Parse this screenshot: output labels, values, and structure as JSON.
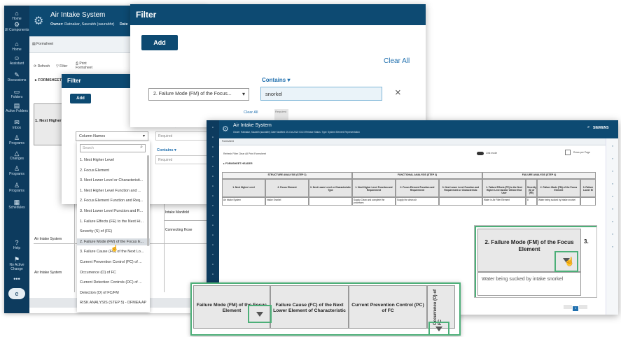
{
  "left_app": {
    "nav": [
      {
        "icon": "⌂",
        "label": "Home"
      },
      {
        "icon": "⚙",
        "label": "UI Components"
      },
      {
        "icon": "⌂",
        "label": "Home"
      },
      {
        "icon": "☺",
        "label": "Assistant"
      },
      {
        "icon": "✎",
        "label": "Discussions"
      },
      {
        "icon": "▭",
        "label": "Folders"
      },
      {
        "icon": "▤",
        "label": "Active Folders"
      },
      {
        "icon": "✉",
        "label": "Inbox"
      },
      {
        "icon": "♙",
        "label": "Programs"
      },
      {
        "icon": "△",
        "label": "Changes"
      },
      {
        "icon": "♙",
        "label": "Programs"
      },
      {
        "icon": "♙",
        "label": "Programs"
      },
      {
        "icon": "▦",
        "label": "Schedules"
      },
      {
        "icon": "?",
        "label": "Help"
      },
      {
        "icon": "⚑",
        "label": "No Active Change"
      },
      {
        "icon": "•••",
        "label": ""
      },
      {
        "icon": "e",
        "label": ""
      }
    ],
    "title": "Air Intake System",
    "owner_label": "Owner:",
    "owner_value": "Ratnakar, Saurabh (saurabhr)",
    "date_label": "Date",
    "tab": "Formsheet",
    "toolbar": {
      "refresh": "Refresh",
      "filter": "Filter",
      "print": "Print Formsheet"
    },
    "section": "FORMSHEET",
    "row_label": "1. Next Higher Level",
    "row_value_1": "Air Intake System",
    "row_value_2": "Air Intake System",
    "cells": {
      "intake_manifold": "Intake Manifold",
      "connecting_hose": "Connecting Hose"
    }
  },
  "small_filter": {
    "title": "Filter",
    "add": "Add",
    "contains_1": "Contains",
    "required_1": "Required",
    "contains_2": "Contains",
    "required_2": "Required",
    "select_value": "Column Names",
    "search_placeholder": "Search",
    "options": [
      "1. Next Higher Level",
      "2. Focus Element",
      "3. Next Lower Level or Characteristi...",
      "1. Next Higher Level Function and ...",
      "2. Focus Element Function and Req...",
      "3. Next Lower Level Function and R...",
      "1. Failure Effects (FE) to the Next Hi...",
      "Severity (S) of (FE)",
      "2. Failure Mode (FM) of the Focus E...",
      "3. Failure Cause (FC) of the Next Lo...",
      "Current Prevention Control (PC) of ...",
      "Occurrence (O) of FC",
      "Current Detection Controls (DC) of ...",
      "Detection (D) of FC/FM",
      "RISK ANALYSIS (STEP 5) - DFMEA AP"
    ]
  },
  "big_filter": {
    "title": "Filter",
    "add": "Add",
    "clear_all": "Clear All",
    "contains": "Contains",
    "select_value": "2. Failure Mode (FM) of the Focus...",
    "input_value": "snorkel",
    "close": "×",
    "clear_all_small": "Clear All",
    "required": "Required"
  },
  "right_app": {
    "title": "Air Intake System",
    "meta": "Owner:  Ratnakar, Saurabh (saurabhr)     Date Modified:  20-Oct-2022 03:23     Release Status:      Type:  System Element Representation",
    "brand": "SIEMENS",
    "tab": "Formsheet",
    "toolbar": "Refresh   Filter   Clear All   Print Formsheet",
    "toggle_label": "Link mode",
    "rows_per_page": "Rows per Page",
    "section": "FORMSHEET HEADER",
    "groups": [
      "STRUCTURE ANALYSIS (STEP 2)",
      "FUNCTIONAL ANALYSIS (STEP 3)",
      "FAILURE ANALYSIS (STEP 4)"
    ],
    "headers": [
      "1. Next Higher Level",
      "2. Focus Element",
      "3. Next Lower Level or Characteristic Type",
      "1. Next Higher Level Function and Requirement",
      "2. Focus Element Function and Requirement",
      "3. Next Lower Level Function and Requirement or Characteristic",
      "1. Failure Effects (FE) to the Next Higher Level and/or Vehicle End User",
      "Severity (S) of (FE)",
      "2. Failure Mode (FM) of the Focus Element",
      "3. Failure Lower El"
    ],
    "row": [
      "Air Intake System",
      "Intake Snorkel",
      "",
      "Supply Clean and complete the processes",
      "Supply the clean air",
      "",
      "Water in Air Filter Element",
      "8",
      "Water being sucked by intake snorkel",
      ""
    ],
    "zoom_header": "2. Failure Mode (FM) of the Focus Element",
    "zoom_header_cut": "3.",
    "zoom_cell": "Water being sucked by intake snorkel",
    "pager": "1",
    "side_icons": [
      "Information",
      "Discussions",
      "Gallery",
      "Tags",
      "Groups",
      "Properties",
      "Favorites",
      "Settings",
      "More"
    ]
  },
  "bottom_zoom": {
    "h1": "Failure Mode (FM) of the Focus Element",
    "h2": "Failure Cause (FC) of the Next Lower Element of Characteristic",
    "h3": "Current Prevention Control (PC) of FC",
    "h4": "Occurrence (O) of FC"
  },
  "colors": {
    "nav": "#0d3b5e",
    "header": "#0d4a72",
    "highlight": "#4caf78",
    "clear_all": "#1f6fae"
  }
}
